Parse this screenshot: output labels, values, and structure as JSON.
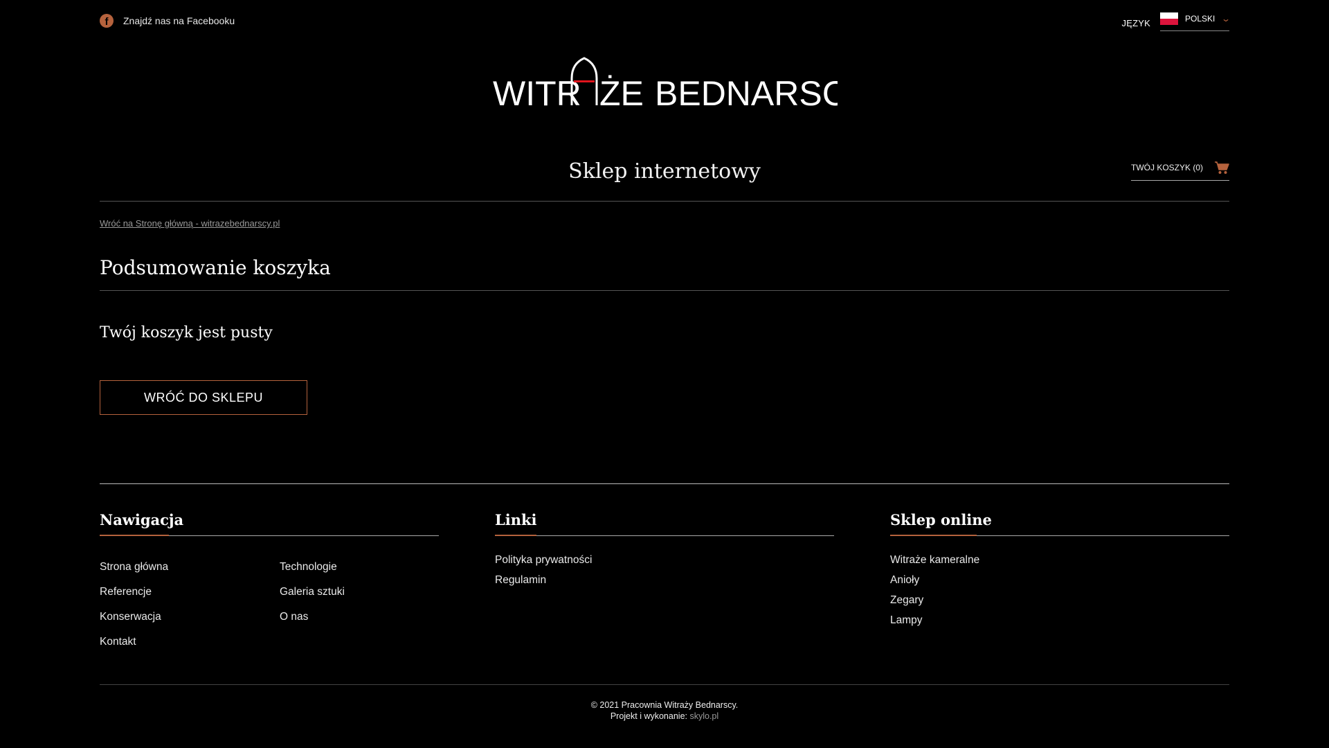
{
  "topbar": {
    "facebook_icon": "facebook-icon",
    "facebook_text": "Znajdź nas na Facebooku",
    "language_label": "JĘZYK",
    "language_value": "POLSKI"
  },
  "logo": {
    "left": "WITR",
    "right": "ŻE",
    "brand": "BEDNARSCY"
  },
  "shop": {
    "title": "Sklep internetowy",
    "cart_label": "TWÓJ KOSZYK (0)"
  },
  "main": {
    "back_link": "Wróć na Stronę główną - witrazebednarscy.pl",
    "page_title": "Podsumowanie koszyka",
    "empty_text": "Twój koszyk jest pusty",
    "back_button": "WRÓĆ DO SKLEPU"
  },
  "footer": {
    "nav": {
      "title": "Nawigacja",
      "items": [
        "Strona główna",
        "Technologie",
        "Referencje",
        "Galeria sztuki",
        "Konserwacja",
        "O nas",
        "Kontakt"
      ]
    },
    "links": {
      "title": "Linki",
      "items": [
        "Polityka prywatności",
        "Regulamin"
      ]
    },
    "shop": {
      "title": "Sklep online",
      "items": [
        "Witraże kameralne",
        "Anioły",
        "Zegary",
        "Lampy"
      ]
    },
    "copyright": "© 2021 Pracownia Witraży Bednarscy.",
    "credit_prefix": "Projekt i wykonanie:",
    "credit_link": "skylo.pl"
  },
  "colors": {
    "accent": "#b5623d",
    "background": "#000000",
    "logo_red": "#e0141c"
  }
}
